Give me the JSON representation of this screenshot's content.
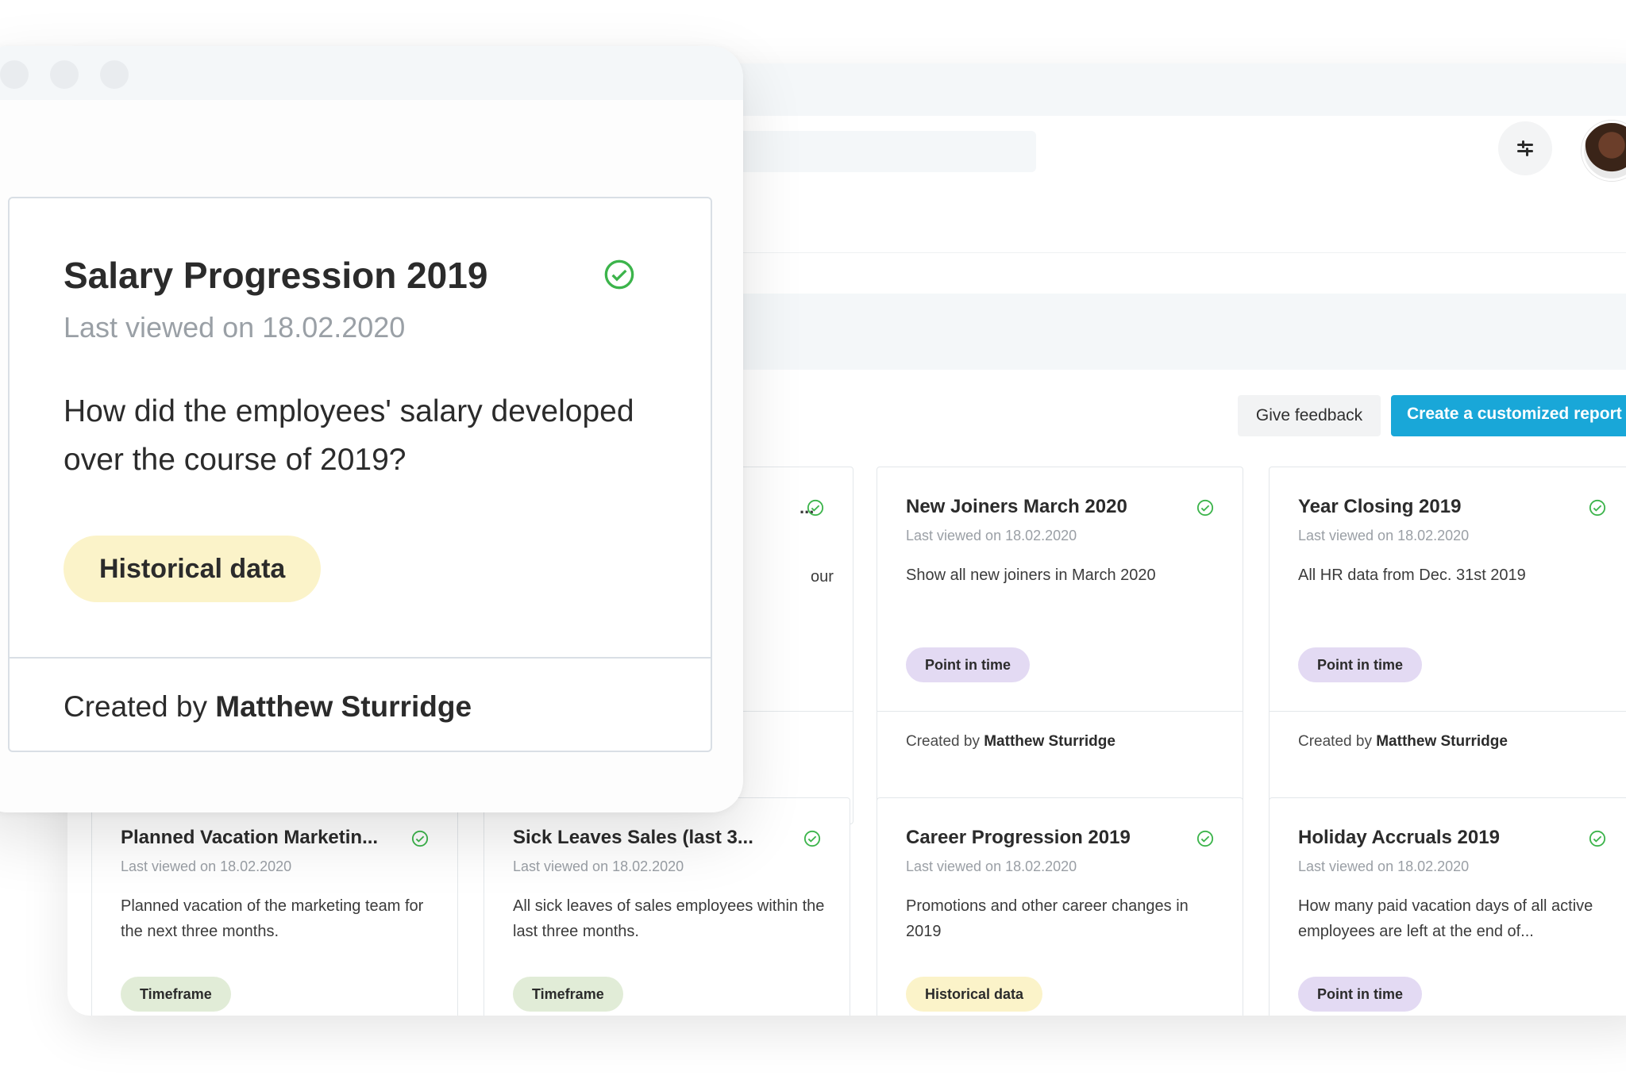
{
  "header": {
    "filter_icon": "sliders-icon"
  },
  "actions": {
    "feedback_label": "Give feedback",
    "create_label": "Create a customized report"
  },
  "focused_report": {
    "title": "Salary Progression 2019",
    "last_viewed": "Last viewed on 18.02.2020",
    "description": "How did the employees' salary developed over the course of 2019?",
    "tag": "Historical data",
    "created_by_prefix": "Created by",
    "author": "Matthew Sturridge"
  },
  "partial_card": {
    "title_fragment": "...",
    "desc_fragment": "our"
  },
  "reports": [
    {
      "title": "New Joiners March 2020",
      "last_viewed": "Last viewed on 18.02.2020",
      "description": "Show all new joiners in March 2020",
      "tag": "Point in time",
      "created_by_prefix": "Created by",
      "author": "Matthew Sturridge"
    },
    {
      "title": "Year Closing 2019",
      "last_viewed": "Last viewed on 18.02.2020",
      "description": "All HR data from Dec. 31st 2019",
      "tag": "Point in time",
      "created_by_prefix": "Created by",
      "author": "Matthew Sturridge"
    },
    {
      "title": "Planned Vacation Marketin...",
      "last_viewed": "Last viewed on 18.02.2020",
      "description": "Planned vacation of the marketing team for the next three months.",
      "tag": "Timeframe"
    },
    {
      "title": "Sick Leaves Sales (last 3...",
      "last_viewed": "Last viewed on 18.02.2020",
      "description": "All sick leaves of sales employees within the last three months.",
      "tag": "Timeframe"
    },
    {
      "title": "Career Progression 2019",
      "last_viewed": "Last viewed on 18.02.2020",
      "description": "Promotions and other career changes in 2019",
      "tag": "Historical data"
    },
    {
      "title": "Holiday Accruals 2019",
      "last_viewed": "Last viewed on 18.02.2020",
      "description": "How many paid vacation days of all active employees are left at the end of...",
      "tag": "Point in time"
    }
  ],
  "colors": {
    "accent": "#19a7d8",
    "check": "#3cb44b",
    "tag_point_in_time": "#e3daf3",
    "tag_timeframe": "#e1ecd7",
    "tag_historical": "#fbf3c9"
  }
}
